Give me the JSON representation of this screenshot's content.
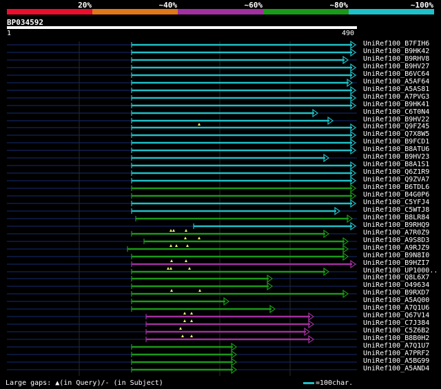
{
  "legend": {
    "segments": [
      {
        "color": "#e8102e",
        "label": "20%"
      },
      {
        "color": "#e2761b",
        "label": "~40%"
      },
      {
        "color": "#a0319f",
        "label": "~60%"
      },
      {
        "color": "#1a9a1a",
        "label": "~80%"
      },
      {
        "color": "#1fc1c9",
        "label": "~100%"
      }
    ]
  },
  "query": {
    "id": "BP034592",
    "start": "1",
    "end": "490"
  },
  "colors": {
    "cyan": "#1fc1c9",
    "green": "#1a9a1a",
    "purple": "#a0319f",
    "dim_line": "#12245e",
    "gap_marker": "#f0f07a"
  },
  "hits": [
    {
      "name": "UniRef100_B7FIH6",
      "color": "cyan"
    },
    {
      "name": "UniRef100_B9HK42",
      "color": "cyan"
    },
    {
      "name": "UniRef100_B9RHV8",
      "color": "cyan"
    },
    {
      "name": "UniRef100_B9HV27",
      "color": "cyan"
    },
    {
      "name": "UniRef100_B6VC64",
      "color": "cyan"
    },
    {
      "name": "UniRef100_A5AF64",
      "color": "cyan"
    },
    {
      "name": "UniRef100_A5AS81",
      "color": "cyan"
    },
    {
      "name": "UniRef100_A7PVG3",
      "color": "cyan"
    },
    {
      "name": "UniRef100_B9HK41",
      "color": "cyan"
    },
    {
      "name": "UniRef100_C6T0N4",
      "color": "cyan"
    },
    {
      "name": "UniRef100_B9HV22",
      "color": "cyan"
    },
    {
      "name": "UniRef100_Q9FZ45",
      "color": "cyan"
    },
    {
      "name": "UniRef100_Q7X8W5",
      "color": "cyan"
    },
    {
      "name": "UniRef100_B9FCD1",
      "color": "cyan"
    },
    {
      "name": "UniRef100_B8ATU6",
      "color": "cyan"
    },
    {
      "name": "UniRef100_B9HV23",
      "color": "cyan"
    },
    {
      "name": "UniRef100_B8A1S1",
      "color": "cyan"
    },
    {
      "name": "UniRef100_Q6Z1R9",
      "color": "cyan"
    },
    {
      "name": "UniRef100_Q9ZVA7",
      "color": "cyan"
    },
    {
      "name": "UniRef100_B6TDL6",
      "color": "green"
    },
    {
      "name": "UniRef100_B4G0P6",
      "color": "green"
    },
    {
      "name": "UniRef100_C5YFJ4",
      "color": "cyan"
    },
    {
      "name": "UniRef100_C5WTJ8",
      "color": "cyan"
    },
    {
      "name": "UniRef100_B8LR84",
      "color": "green"
    },
    {
      "name": "UniRef100_B9RHQ9",
      "color": "cyan"
    },
    {
      "name": "UniRef100_A7R0Z9",
      "color": "green"
    },
    {
      "name": "UniRef100_A9S8D3",
      "color": "green"
    },
    {
      "name": "UniRef100_A9RJZ9",
      "color": "green"
    },
    {
      "name": "UniRef100_B9N8I0",
      "color": "green"
    },
    {
      "name": "UniRef100_B9HZI7",
      "color": "purple"
    },
    {
      "name": "UniRef100_UP1000..",
      "color": "green"
    },
    {
      "name": "UniRef100_Q8L6X7",
      "color": "green"
    },
    {
      "name": "UniRef100_O49634",
      "color": "green"
    },
    {
      "name": "UniRef100_B9RXD7",
      "color": "green"
    },
    {
      "name": "UniRef100_A5AQ00",
      "color": "green"
    },
    {
      "name": "UniRef100_A7Q1U6",
      "color": "green"
    },
    {
      "name": "UniRef100_Q67V14",
      "color": "purple"
    },
    {
      "name": "UniRef100_C7J384",
      "color": "purple"
    },
    {
      "name": "UniRef100_C5Z6B2",
      "color": "purple"
    },
    {
      "name": "UniRef100_B8B0H2",
      "color": "purple"
    },
    {
      "name": "UniRef100_A7Q1U7",
      "color": "green"
    },
    {
      "name": "UniRef100_A7PRF2",
      "color": "green"
    },
    {
      "name": "UniRef100_A5BG99",
      "color": "green"
    },
    {
      "name": "UniRef100_A5AND4",
      "color": "green"
    }
  ],
  "footer": {
    "gaps_text": "Large gaps: ▲(in Query)/- (in Subject)",
    "scale_text": "=100char."
  }
}
